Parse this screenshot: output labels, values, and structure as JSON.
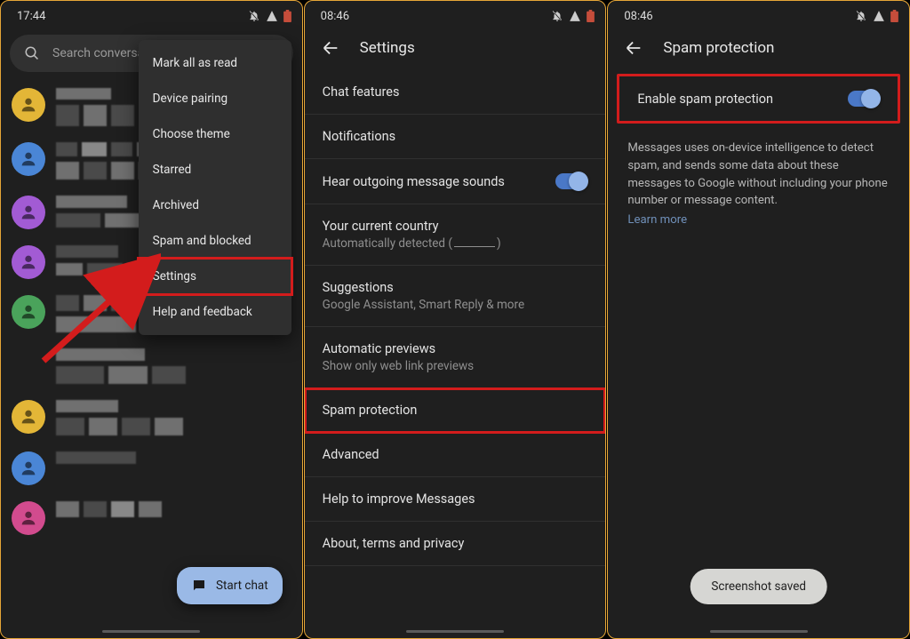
{
  "panel1": {
    "time": "17:44",
    "search_placeholder": "Search conversations",
    "menu": {
      "mark_all": "Mark all as read",
      "device_pairing": "Device pairing",
      "choose_theme": "Choose theme",
      "starred": "Starred",
      "archived": "Archived",
      "spam_blocked": "Spam and blocked",
      "settings": "Settings",
      "help": "Help and feedback"
    },
    "fab": "Start chat"
  },
  "panel2": {
    "time": "08:46",
    "title": "Settings",
    "items": {
      "chat_features": "Chat features",
      "notifications": "Notifications",
      "hear_sounds": "Hear outgoing message sounds",
      "country_t": "Your current country",
      "country_s_pre": "Automatically detected (",
      "country_s_post": ")",
      "suggestions_t": "Suggestions",
      "suggestions_s": "Google Assistant, Smart Reply & more",
      "previews_t": "Automatic previews",
      "previews_s": "Show only web link previews",
      "spam_protection": "Spam protection",
      "advanced": "Advanced",
      "help_improve": "Help to improve Messages",
      "about": "About, terms and privacy"
    }
  },
  "panel3": {
    "time": "08:46",
    "title": "Spam protection",
    "enable_label": "Enable spam protection",
    "desc": "Messages uses on-device intelligence to detect spam, and sends some data about these messages to Google without including your phone number or message content.",
    "learn_more": "Learn more",
    "toast": "Screenshot saved"
  }
}
